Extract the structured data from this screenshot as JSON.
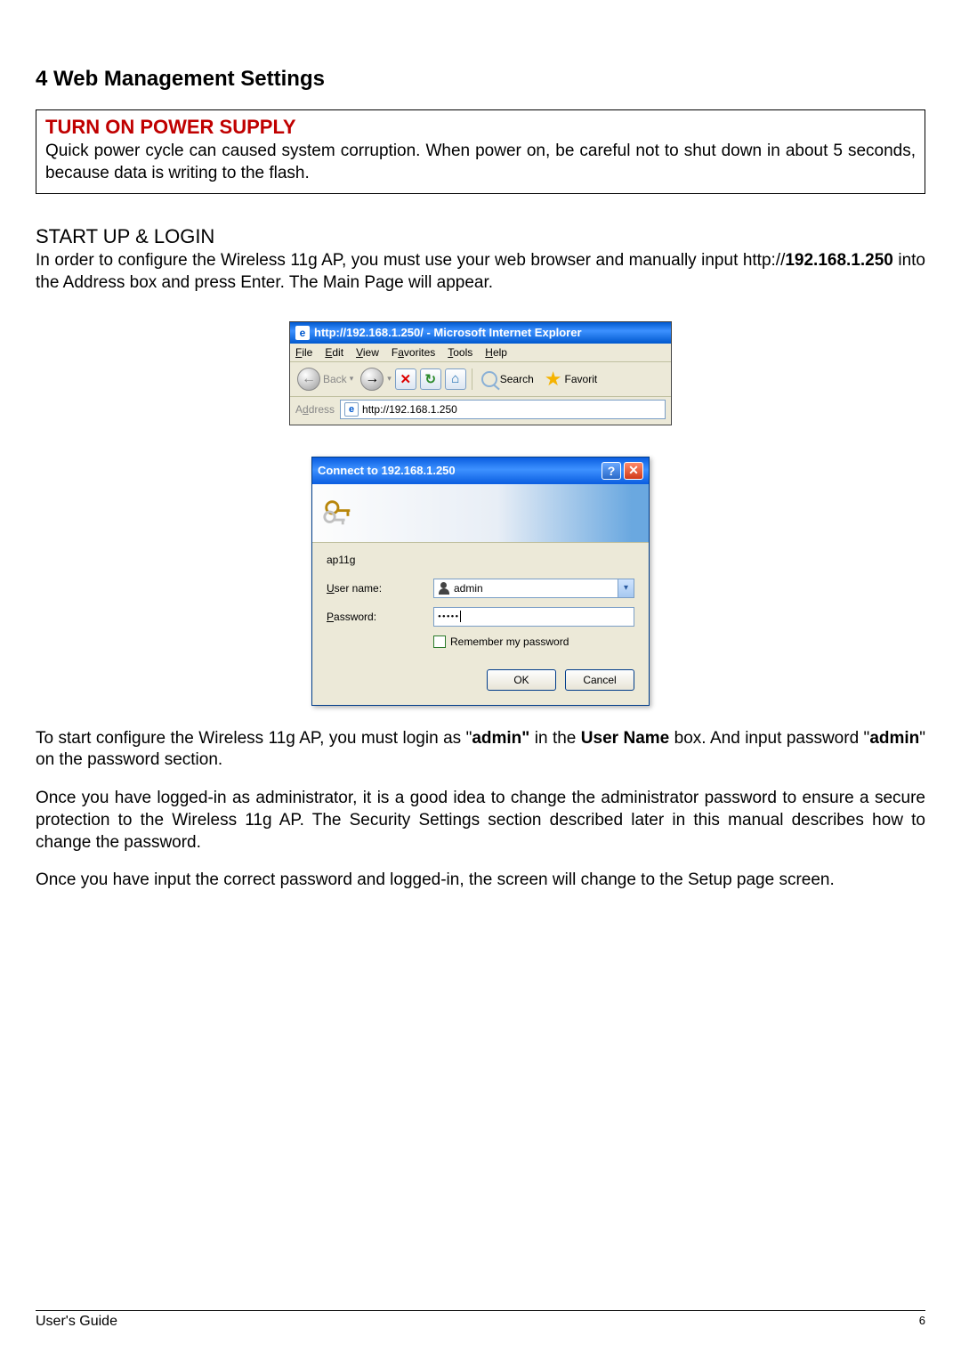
{
  "heading": "4 Web Management Settings",
  "warning": {
    "title": "TURN ON POWER SUPPLY",
    "text": "Quick power cycle can caused system corruption. When power on, be careful not to shut down in about 5 seconds, because data is writing to the flash."
  },
  "startup": {
    "subheading": "START UP & LOGIN",
    "intro_pre": "In order to configure the Wireless 11g AP, you must use your web browser and manually input http://",
    "intro_bold": "192.168.1.250",
    "intro_post": " into the Address box and press Enter. The Main Page will appear."
  },
  "ie": {
    "title": "http://192.168.1.250/ - Microsoft Internet Explorer",
    "menu": {
      "file": "File",
      "edit": "Edit",
      "view": "View",
      "favorites": "Favorites",
      "tools": "Tools",
      "help": "Help"
    },
    "toolbar": {
      "back": "Back",
      "search": "Search",
      "favorites": "Favorit"
    },
    "address_label": "Address",
    "address_value": "http://192.168.1.250"
  },
  "dialog": {
    "title": "Connect to 192.168.1.250",
    "realm": "ap11g",
    "username_label": "User name:",
    "username_value": "admin",
    "password_label": "Password:",
    "password_value": "•••••",
    "remember": "Remember my password",
    "ok": "OK",
    "cancel": "Cancel"
  },
  "paras": {
    "p1a": "To start configure the Wireless 11g AP, you must login as \"",
    "p1b": "admin\"",
    "p1c": " in the ",
    "p1d": "User Name",
    "p1e": " box. And input password \"",
    "p1f": "admin",
    "p1g": "\" on the password section.",
    "p2": "Once you have logged-in as administrator, it is a good idea to change the administrator password to ensure a secure protection to the Wireless 11g AP. The Security Settings section described later in this manual describes how to change the password.",
    "p3": "Once you have input the correct password and logged-in, the screen will change to the Setup page screen."
  },
  "footer": {
    "guide": "User's Guide",
    "page": "6"
  }
}
